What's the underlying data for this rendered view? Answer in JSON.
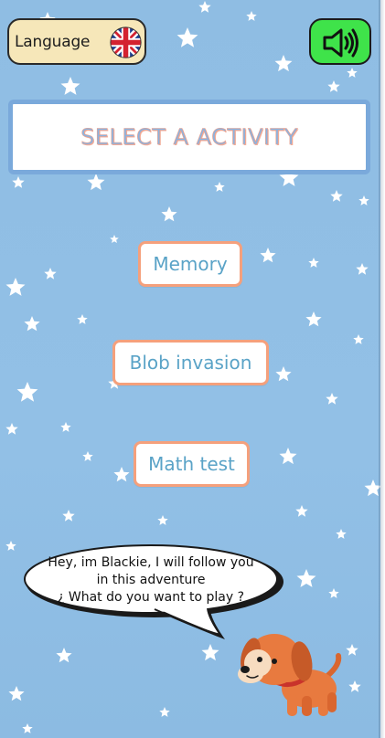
{
  "header": {
    "language_label": "Language",
    "language_flag_icon": "uk-flag-icon",
    "sound_icon": "speaker-volume-icon"
  },
  "title": "SELECT A ACTIVITY",
  "activities": [
    {
      "label": "Memory"
    },
    {
      "label": "Blob invasion"
    },
    {
      "label": "Math test"
    }
  ],
  "mascot": {
    "speech_lines": [
      "Hey, im Blackie, I will follow you",
      "in this adventure",
      "¿ What do you want to play ?"
    ],
    "icon": "puppy-mascot-icon"
  },
  "colors": {
    "background": "#8fbde3",
    "button_border": "#f5a07c",
    "button_text": "#5aa3c7",
    "title_border": "#7aa9db",
    "sound_button": "#3fe34a",
    "language_button": "#f6e7b9"
  }
}
